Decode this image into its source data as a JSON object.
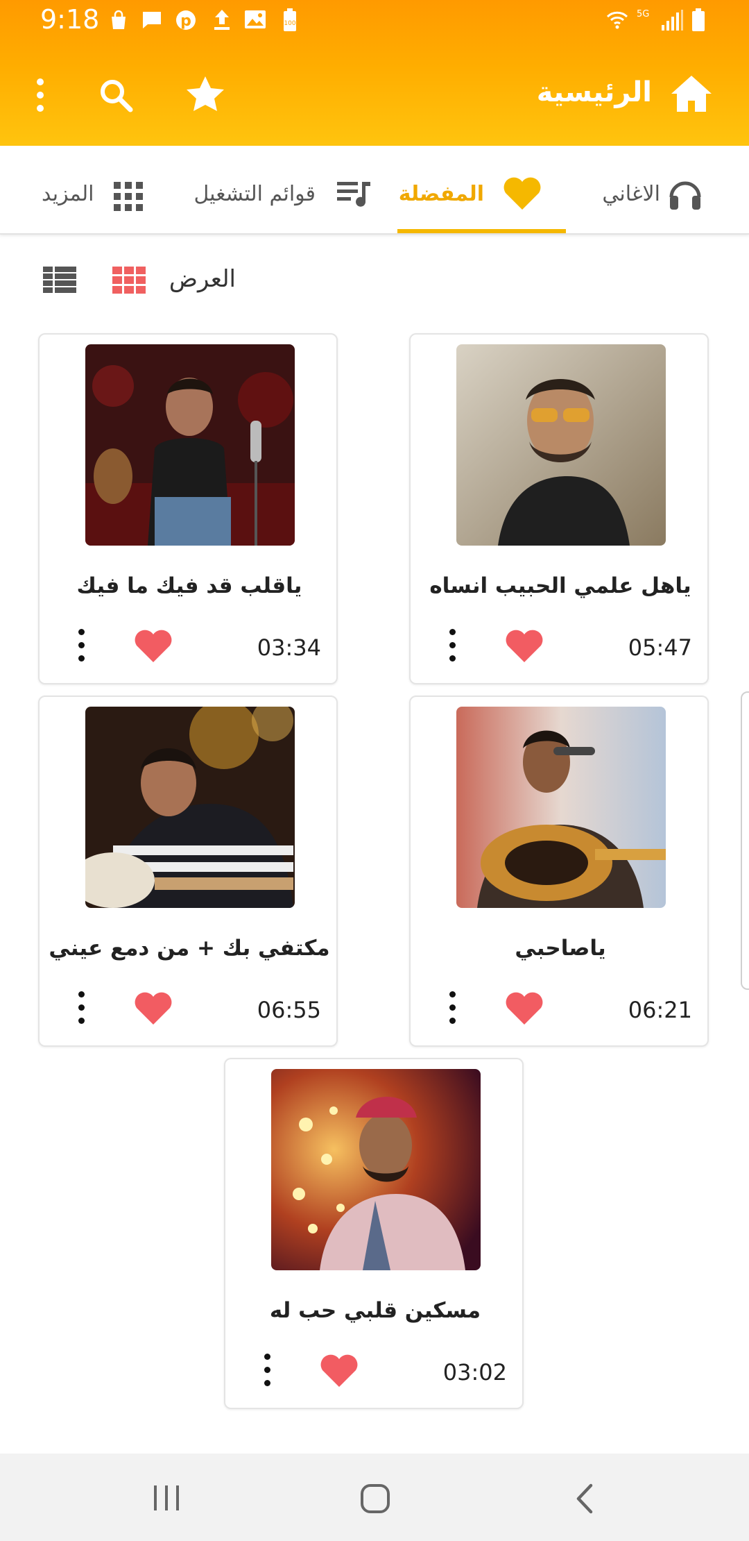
{
  "status_bar": {
    "time": "9:18",
    "icons": [
      "shopping-bag-icon",
      "message-icon",
      "pinterest-icon",
      "upload-icon",
      "image-icon",
      "battery-100-icon",
      "wifi-icon",
      "5g-icon",
      "signal-icon",
      "battery-icon"
    ]
  },
  "header": {
    "title": "الرئيسية",
    "icons": [
      "home-icon",
      "star-icon",
      "search-icon",
      "more-vert-icon"
    ]
  },
  "tabs": [
    {
      "label": "الاغاني",
      "icon": "headphones-icon",
      "active": false
    },
    {
      "label": "المفضلة",
      "icon": "heart-icon",
      "active": true
    },
    {
      "label": "قوائم التشغيل",
      "icon": "playlist-icon",
      "active": false
    },
    {
      "label": "المزيد",
      "icon": "apps-grid-icon",
      "active": false
    }
  ],
  "colors": {
    "accent": "#f5b800",
    "active_tab": "#f0a800",
    "heart": "#f25c62",
    "grid_view_icon": "#f06060"
  },
  "view_toggle": {
    "label": "العرض",
    "options": [
      "grid-view-icon",
      "list-view-icon"
    ],
    "selected": "grid-view-icon"
  },
  "songs": [
    {
      "title": "ياهل علمي الحبيب انساه",
      "duration": "05:47",
      "favorite": true
    },
    {
      "title": "ياقلب قد فيك ما فيك",
      "duration": "03:34",
      "favorite": true
    },
    {
      "title": "ياصاحبي",
      "duration": "06:21",
      "favorite": true
    },
    {
      "title": "مكتفي بك + من دمع عيني",
      "duration": "06:55",
      "favorite": true
    },
    {
      "title": "مسكين قلبي حب له",
      "duration": "03:02",
      "favorite": true
    }
  ],
  "nav_bar": {
    "buttons": [
      "recent-apps-icon",
      "home-button-icon",
      "back-icon"
    ]
  }
}
